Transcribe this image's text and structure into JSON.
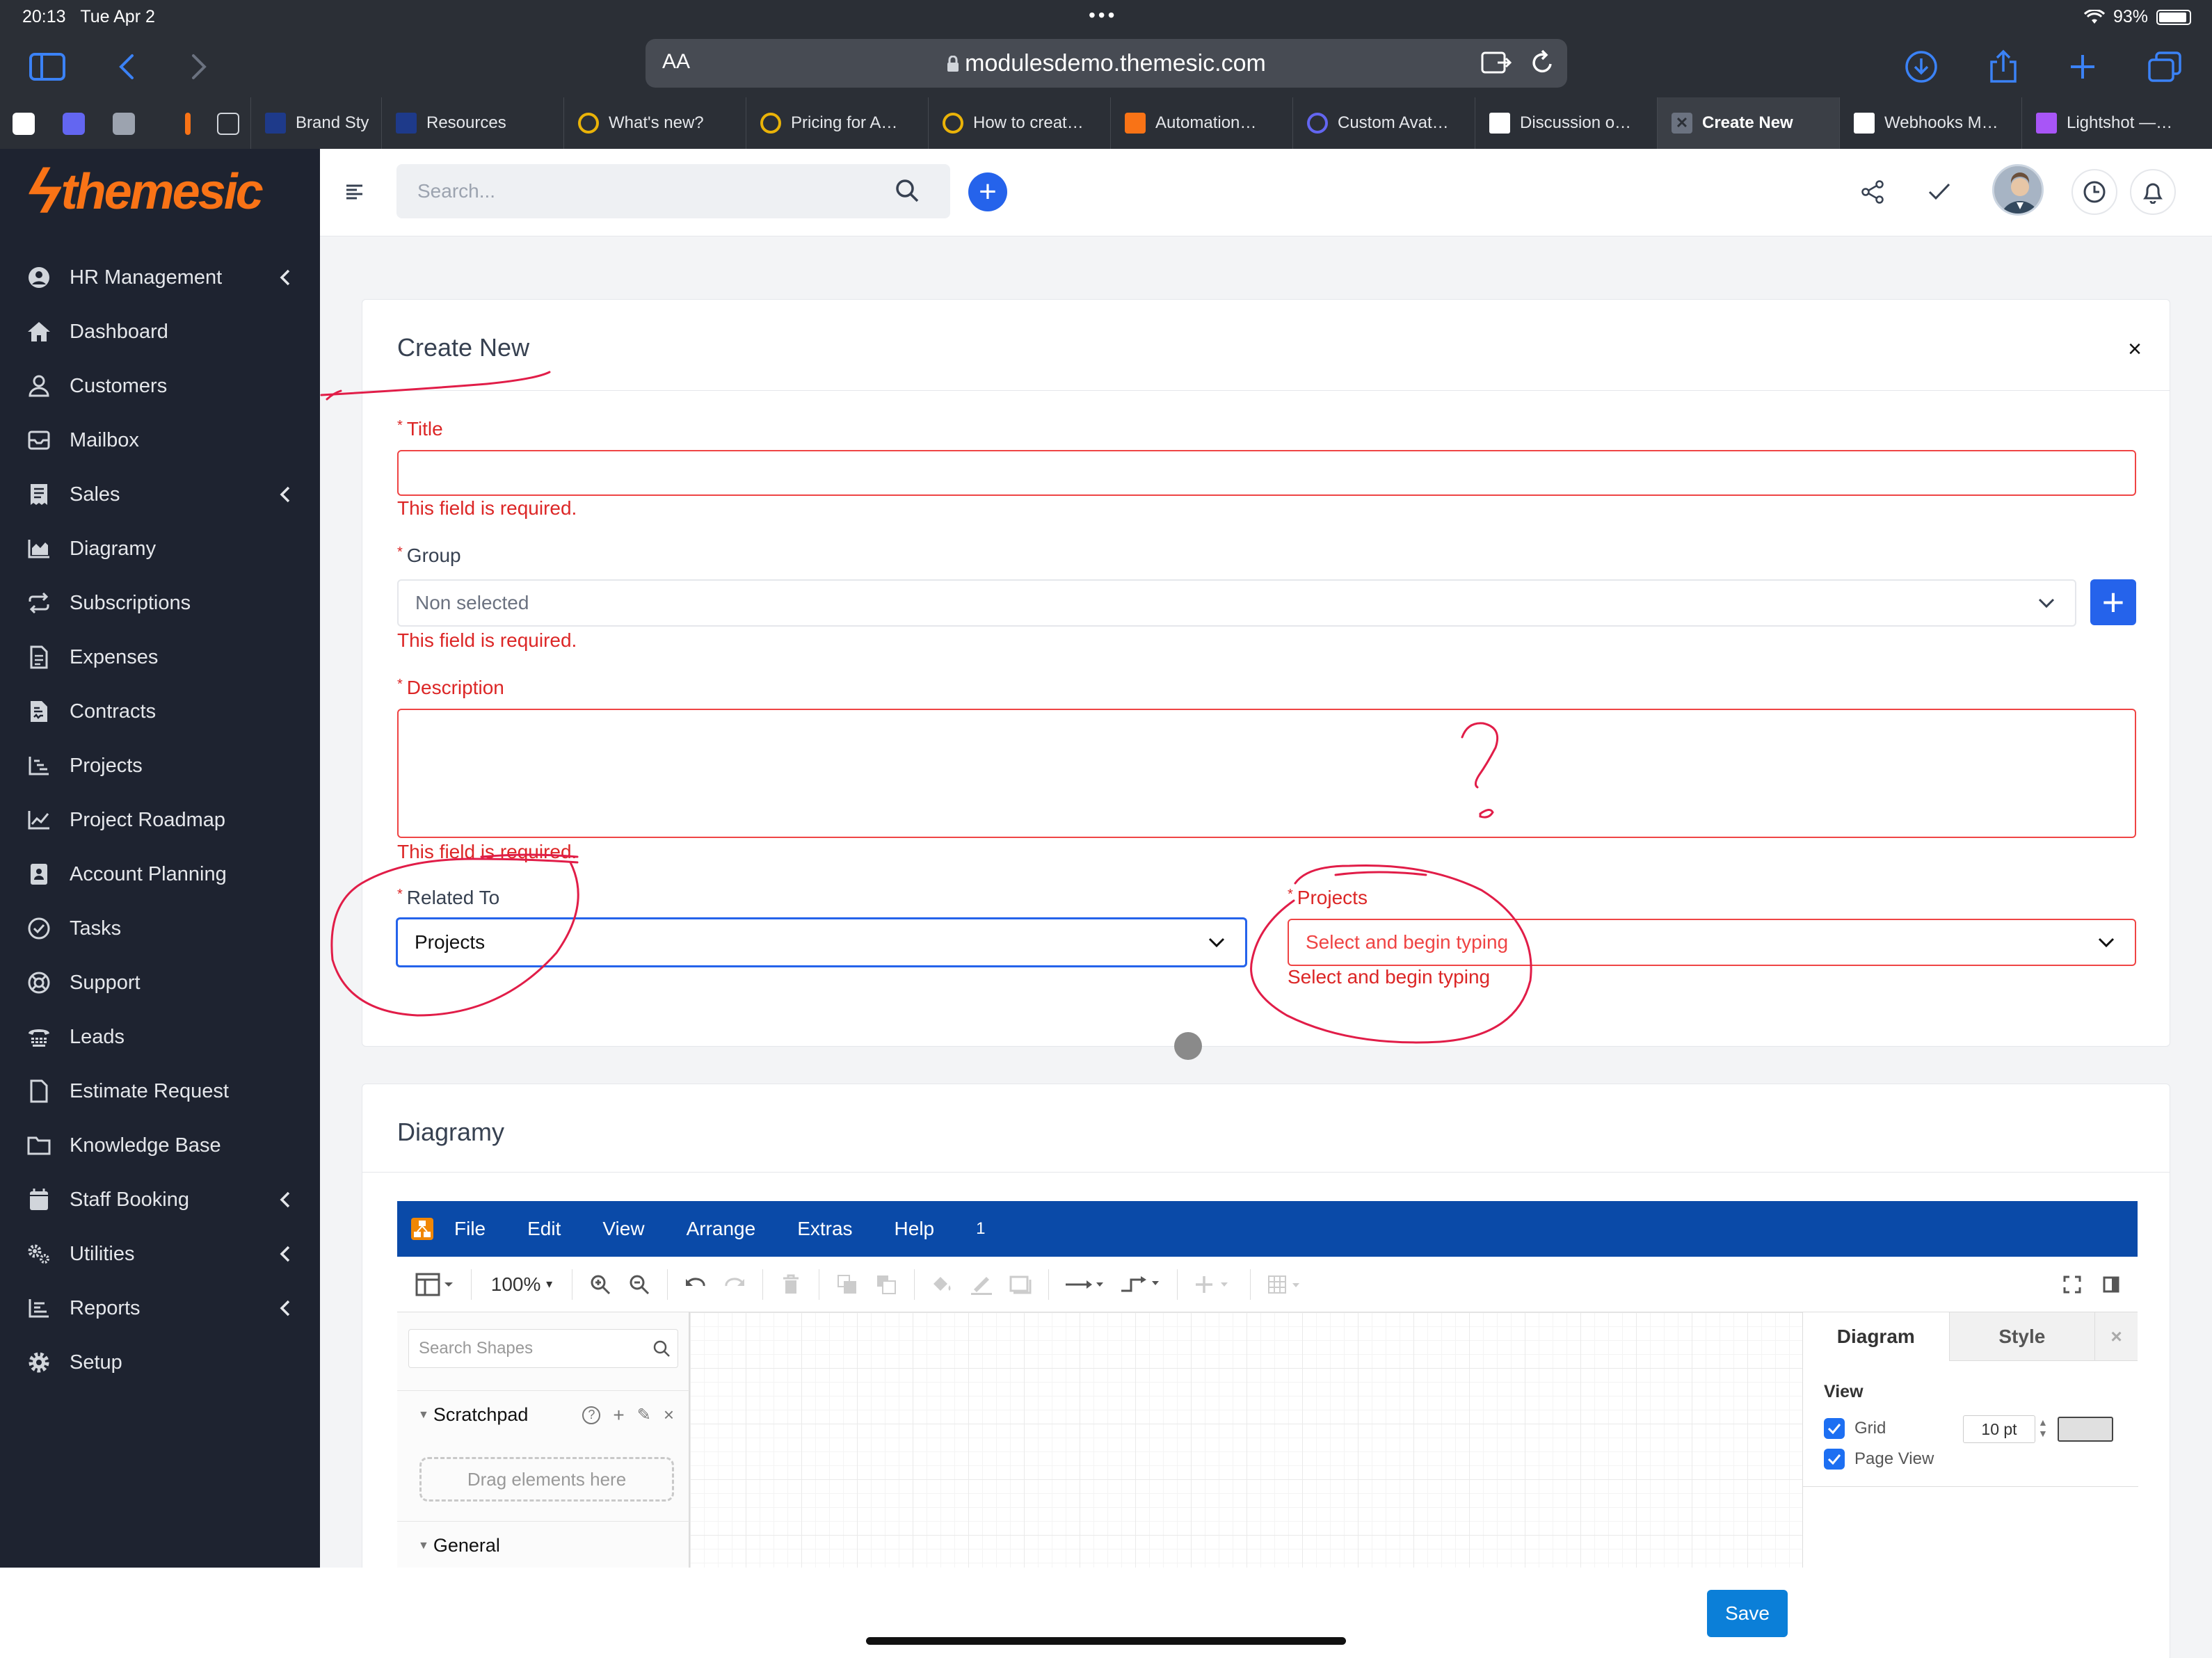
{
  "status": {
    "time": "20:13",
    "date": "Tue Apr 2",
    "battery": "93%"
  },
  "browser": {
    "text_size": "AA",
    "url": "modulesdemo.themesic.com",
    "tabs": [
      {
        "title": "Brand Sty",
        "color": "#1e3a8a"
      },
      {
        "title": "Resources",
        "color": "#1e3a8a"
      },
      {
        "title": "What's new?",
        "color": "#eab308"
      },
      {
        "title": "Pricing for A…",
        "color": "#eab308"
      },
      {
        "title": "How to creat…",
        "color": "#eab308"
      },
      {
        "title": "Automation…",
        "color": "#f97316"
      },
      {
        "title": "Custom Avat…",
        "color": "#6366f1"
      },
      {
        "title": "Discussion o…",
        "color": "#ffffff"
      },
      {
        "title": "Create New",
        "color": "#6b7280"
      },
      {
        "title": "Webhooks M…",
        "color": "#ffffff"
      },
      {
        "title": "Lightshot —…",
        "color": "#a855f7"
      }
    ]
  },
  "brand": {
    "name": "themesic",
    "accent": "#f97316"
  },
  "sidebar": {
    "items": [
      {
        "label": "HR Management",
        "icon": "user-circle-icon",
        "submenu": true
      },
      {
        "label": "Dashboard",
        "icon": "home-icon",
        "submenu": false
      },
      {
        "label": "Customers",
        "icon": "user-icon",
        "submenu": false
      },
      {
        "label": "Mailbox",
        "icon": "mail-icon",
        "submenu": false
      },
      {
        "label": "Sales",
        "icon": "receipt-icon",
        "submenu": true
      },
      {
        "label": "Diagramy",
        "icon": "chart-area-icon",
        "submenu": false
      },
      {
        "label": "Subscriptions",
        "icon": "repeat-icon",
        "submenu": false
      },
      {
        "label": "Expenses",
        "icon": "file-text-icon",
        "submenu": false
      },
      {
        "label": "Contracts",
        "icon": "file-contract-icon",
        "submenu": false
      },
      {
        "label": "Projects",
        "icon": "bars-staggered-icon",
        "submenu": false
      },
      {
        "label": "Project Roadmap",
        "icon": "line-chart-icon",
        "submenu": false
      },
      {
        "label": "Account Planning",
        "icon": "id-card-icon",
        "submenu": false
      },
      {
        "label": "Tasks",
        "icon": "check-circle-icon",
        "submenu": false
      },
      {
        "label": "Support",
        "icon": "life-ring-icon",
        "submenu": false
      },
      {
        "label": "Leads",
        "icon": "tty-icon",
        "submenu": false
      },
      {
        "label": "Estimate Request",
        "icon": "file-icon",
        "submenu": false
      },
      {
        "label": "Knowledge Base",
        "icon": "folder-icon",
        "submenu": false
      },
      {
        "label": "Staff Booking",
        "icon": "calendar-icon",
        "submenu": true
      },
      {
        "label": "Utilities",
        "icon": "gears-icon",
        "submenu": true
      },
      {
        "label": "Reports",
        "icon": "list-chart-icon",
        "submenu": true
      },
      {
        "label": "Setup",
        "icon": "gear-icon",
        "submenu": false
      }
    ]
  },
  "header": {
    "search_placeholder": "Search..."
  },
  "form": {
    "title": "Create New",
    "fields": {
      "title_label": "Title",
      "title_error": "This field is required.",
      "group_label": "Group",
      "group_value": "Non selected",
      "group_error": "This field is required.",
      "description_label": "Description",
      "description_error": "This field is required.",
      "related_label": "Related To",
      "related_value": "Projects",
      "projects_label": "Projects",
      "projects_placeholder": "Select and begin typing",
      "projects_error": "Select and begin typing"
    },
    "error_color": "#dc2626",
    "primary_color": "#2563eb"
  },
  "diagramy": {
    "title": "Diagramy",
    "menu": [
      "File",
      "Edit",
      "View",
      "Arrange",
      "Extras",
      "Help",
      "1"
    ],
    "zoom": "100%",
    "shapes_search_placeholder": "Search Shapes",
    "scratchpad": "Scratchpad",
    "drop_hint": "Drag elements here",
    "general": "General",
    "format_tabs": [
      "Diagram",
      "Style"
    ],
    "view_heading": "View",
    "grid_label": "Grid",
    "grid_size": "10 pt",
    "page_view_label": "Page View"
  },
  "footer": {
    "save_label": "Save"
  }
}
